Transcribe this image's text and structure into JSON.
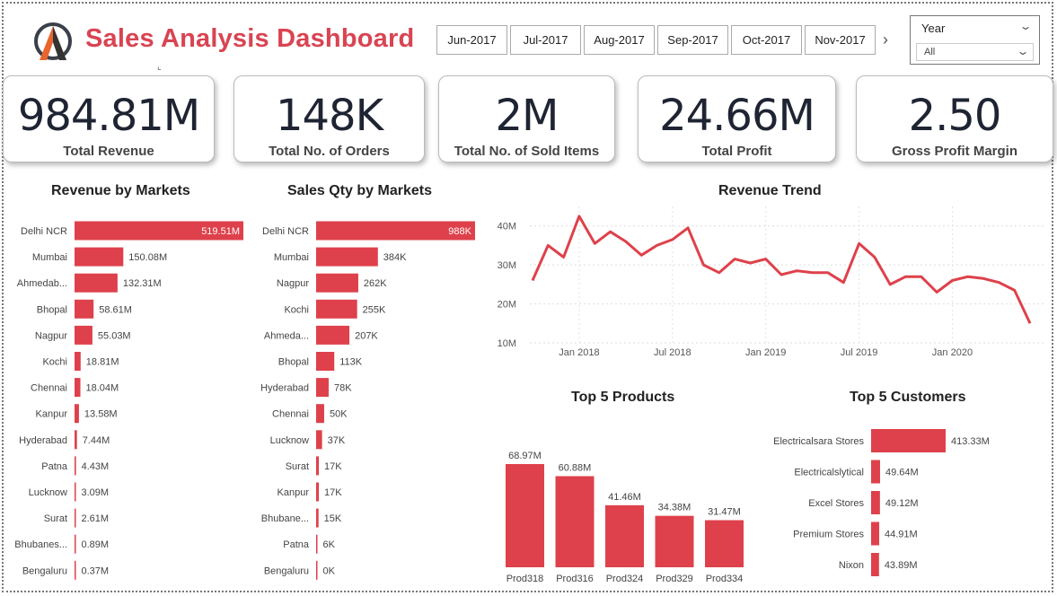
{
  "header": {
    "title": "Sales Analysis Dashboard",
    "months": [
      "Jun-2017",
      "Jul-2017",
      "Aug-2017",
      "Sep-2017",
      "Oct-2017",
      "Nov-2017"
    ],
    "year_slicer": {
      "title": "Year",
      "value": "All"
    }
  },
  "kpis": [
    {
      "value": "984.81M",
      "label": "Total Revenue"
    },
    {
      "value": "148K",
      "label": "Total No. of Orders"
    },
    {
      "value": "2M",
      "label": "Total No. of Sold Items"
    },
    {
      "value": "24.66M",
      "label": "Total Profit"
    },
    {
      "value": "2.50",
      "label": "Gross Profit Margin"
    }
  ],
  "colors": {
    "accent": "#de414b",
    "title": "#d94452"
  },
  "chart_data": [
    {
      "type": "bar",
      "orientation": "horizontal",
      "title": "Revenue by Markets",
      "categories": [
        "Delhi NCR",
        "Mumbai",
        "Ahmedab...",
        "Bhopal",
        "Nagpur",
        "Kochi",
        "Chennai",
        "Kanpur",
        "Hyderabad",
        "Patna",
        "Lucknow",
        "Surat",
        "Bhubanes...",
        "Bengaluru"
      ],
      "values": [
        519.51,
        150.08,
        132.31,
        58.61,
        55.03,
        18.81,
        18.04,
        13.58,
        7.44,
        4.43,
        3.09,
        2.61,
        0.89,
        0.37
      ],
      "labels": [
        "519.51M",
        "150.08M",
        "132.31M",
        "58.61M",
        "55.03M",
        "18.81M",
        "18.04M",
        "13.58M",
        "7.44M",
        "4.43M",
        "3.09M",
        "2.61M",
        "0.89M",
        "0.37M"
      ],
      "unit": "M"
    },
    {
      "type": "bar",
      "orientation": "horizontal",
      "title": "Sales Qty by Markets",
      "categories": [
        "Delhi NCR",
        "Mumbai",
        "Nagpur",
        "Kochi",
        "Ahmeda...",
        "Bhopal",
        "Hyderabad",
        "Chennai",
        "Lucknow",
        "Surat",
        "Kanpur",
        "Bhubane...",
        "Patna",
        "Bengaluru"
      ],
      "values": [
        988,
        384,
        262,
        255,
        207,
        113,
        78,
        50,
        37,
        17,
        17,
        15,
        6,
        0
      ],
      "labels": [
        "988K",
        "384K",
        "262K",
        "255K",
        "207K",
        "113K",
        "78K",
        "50K",
        "37K",
        "17K",
        "17K",
        "15K",
        "6K",
        "0K"
      ],
      "unit": "K"
    },
    {
      "type": "line",
      "title": "Revenue Trend",
      "x": [
        "2017-10",
        "2017-11",
        "2017-12",
        "2018-01",
        "2018-02",
        "2018-03",
        "2018-04",
        "2018-05",
        "2018-06",
        "2018-07",
        "2018-08",
        "2018-09",
        "2018-10",
        "2018-11",
        "2018-12",
        "2019-01",
        "2019-02",
        "2019-03",
        "2019-04",
        "2019-05",
        "2019-06",
        "2019-07",
        "2019-08",
        "2019-09",
        "2019-10",
        "2019-11",
        "2019-12",
        "2020-01",
        "2020-02",
        "2020-03",
        "2020-04",
        "2020-05",
        "2020-06"
      ],
      "y": [
        26,
        35,
        32,
        42.5,
        35.5,
        38.5,
        36,
        32.5,
        35,
        36.5,
        39.5,
        30,
        28,
        31.5,
        30.5,
        31.5,
        27.5,
        28.5,
        28,
        28,
        25.5,
        35.5,
        32,
        25,
        27,
        27,
        23,
        26,
        27,
        26.5,
        25.5,
        23.5,
        15
      ],
      "y_ticks": [
        "10M",
        "20M",
        "30M",
        "40M"
      ],
      "yticks_values": [
        10,
        20,
        30,
        40
      ],
      "x_ticks": [
        "Jan 2018",
        "Jul 2018",
        "Jan 2019",
        "Jul 2019",
        "Jan 2020"
      ],
      "xticks_values": [
        "2018-01",
        "2018-07",
        "2019-01",
        "2019-07",
        "2020-01"
      ],
      "ylim": [
        10,
        45
      ],
      "grid": true
    },
    {
      "type": "bar",
      "title": "Top 5 Products",
      "categories": [
        "Prod318",
        "Prod316",
        "Prod324",
        "Prod329",
        "Prod334"
      ],
      "values": [
        68.97,
        60.88,
        41.46,
        34.38,
        31.47
      ],
      "labels": [
        "68.97M",
        "60.88M",
        "41.46M",
        "34.38M",
        "31.47M"
      ]
    },
    {
      "type": "bar",
      "orientation": "horizontal",
      "title": "Top 5 Customers",
      "categories": [
        "Electricalsara Stores",
        "Electricalslytical",
        "Excel Stores",
        "Premium Stores",
        "Nixon"
      ],
      "values": [
        413.33,
        49.64,
        49.12,
        44.91,
        43.89
      ],
      "labels": [
        "413.33M",
        "49.64M",
        "49.12M",
        "44.91M",
        "43.89M"
      ]
    }
  ]
}
